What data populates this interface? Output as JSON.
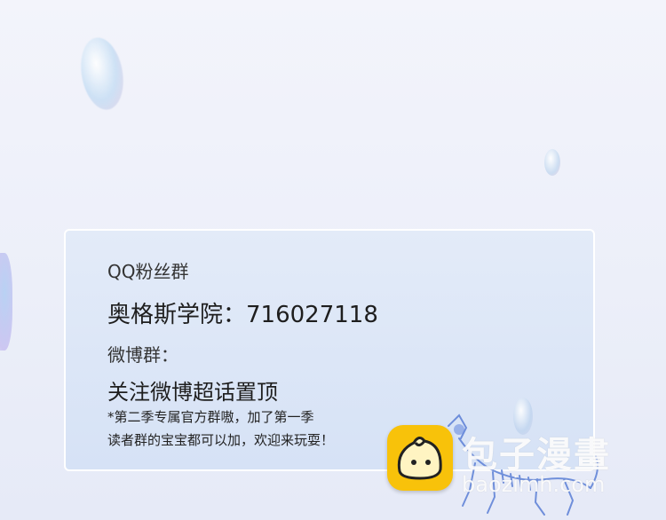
{
  "card": {
    "qq_label": "QQ粉丝群",
    "qq_group": "奥格斯学院：716027118",
    "weibo_label": "微博群：",
    "weibo_action": "关注微博超话置顶",
    "note_line1": "*第二季专属官方群嗷，加了第一季",
    "note_line2": "读者群的宝宝都可以加，欢迎来玩耍！"
  },
  "watermark": {
    "name": "包子漫畫",
    "url": "baozimh.com",
    "icon": "baozi-bun-icon",
    "icon_color": "#f8c20a"
  },
  "decor": {
    "skeleton": "skeleton-illustration"
  }
}
